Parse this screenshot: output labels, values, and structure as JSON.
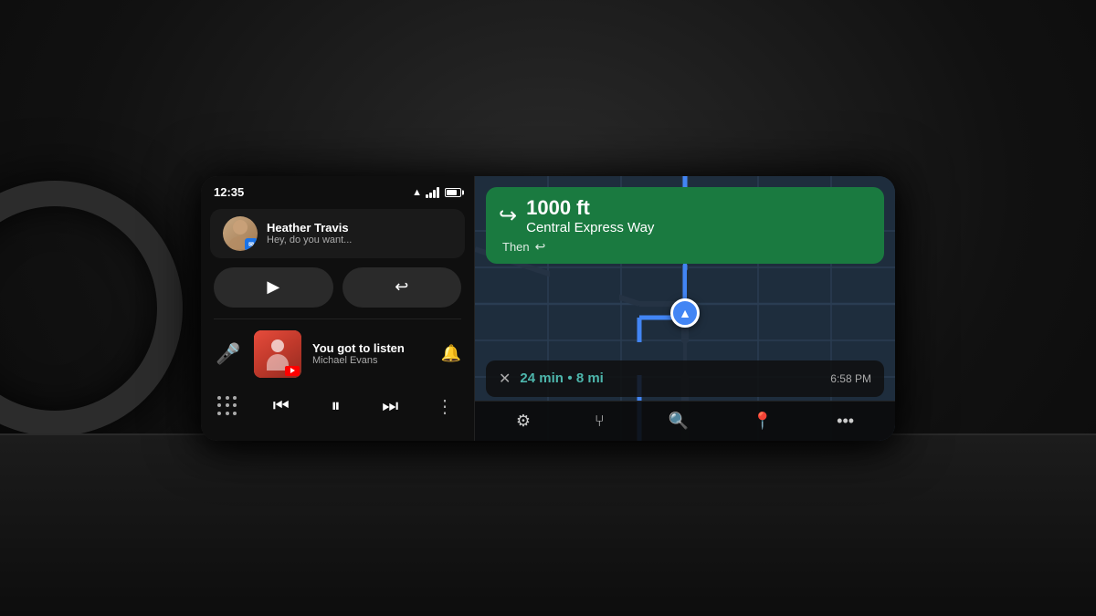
{
  "screen": {
    "status_bar": {
      "time": "12:35"
    },
    "message": {
      "sender": "Heather Travis",
      "preview": "Hey, do you want...",
      "play_label": "▶",
      "reply_label": "↩"
    },
    "music": {
      "title": "You got to listen",
      "artist": "Michael Evans"
    },
    "navigation": {
      "distance": "1000 ft",
      "street": "Central Express Way",
      "then_label": "Then",
      "then_icon": "↩",
      "eta_time": "24 min",
      "eta_dot": "•",
      "eta_distance": "8 mi",
      "eta_arrival": "6:58 PM"
    },
    "map_controls": {
      "settings": "⚙",
      "fork": "⑂",
      "search": "🔍",
      "pin": "📍",
      "more": "…"
    }
  }
}
